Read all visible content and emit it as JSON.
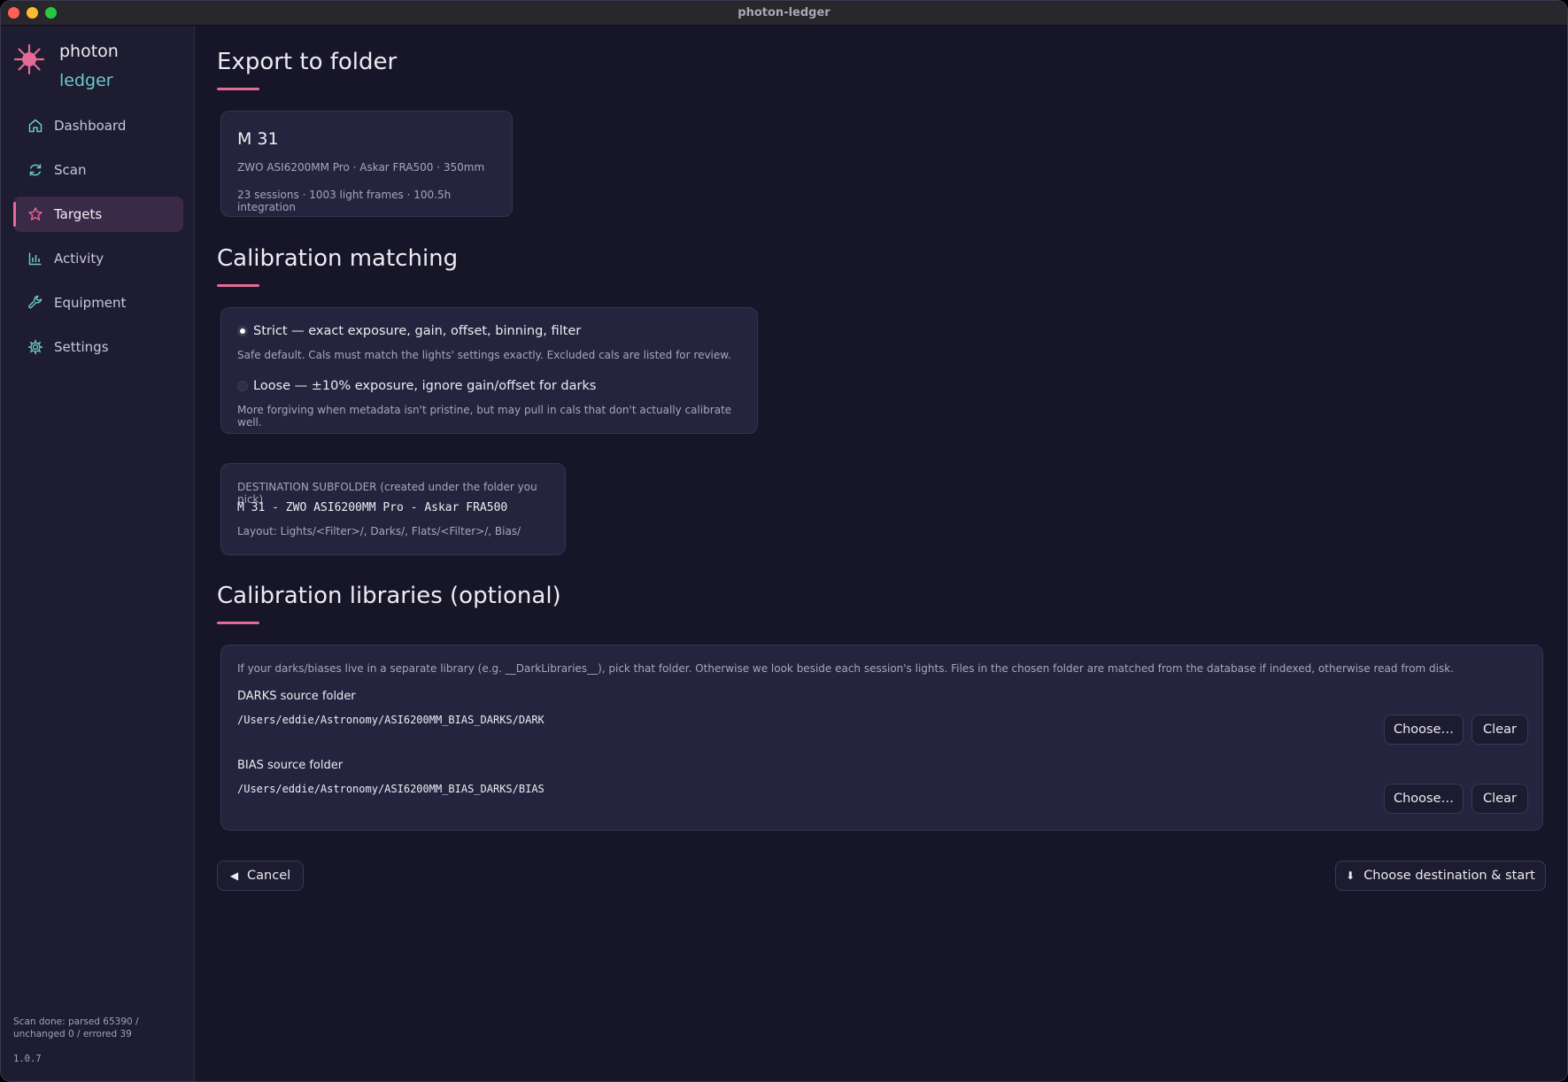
{
  "window": {
    "title": "photon-ledger"
  },
  "sidebar": {
    "brand_line1": "photon",
    "brand_line2": "ledger",
    "items": [
      {
        "label": "Dashboard",
        "icon": "home-icon",
        "active": false
      },
      {
        "label": "Scan",
        "icon": "refresh-icon",
        "active": false
      },
      {
        "label": "Targets",
        "icon": "star-icon",
        "active": true
      },
      {
        "label": "Activity",
        "icon": "bar-chart-icon",
        "active": false
      },
      {
        "label": "Equipment",
        "icon": "wrench-icon",
        "active": false
      },
      {
        "label": "Settings",
        "icon": "gear-icon",
        "active": false
      }
    ],
    "scan_status": "Scan done: parsed 65390 / unchanged 0 / errored 39",
    "version": "1.0.7"
  },
  "export": {
    "heading": "Export to folder",
    "target": {
      "name": "M 31",
      "equipment": "ZWO ASI6200MM Pro · Askar FRA500 · 350mm",
      "stats": "23 sessions · 1003 light frames · 100.5h integration"
    }
  },
  "calibration": {
    "heading": "Calibration matching",
    "options": [
      {
        "label": "Strict — exact exposure, gain, offset, binning, filter",
        "desc": "Safe default. Cals must match the lights' settings exactly. Excluded cals are listed for review.",
        "selected": true
      },
      {
        "label": "Loose — ±10% exposure, ignore gain/offset for darks",
        "desc": "More forgiving when metadata isn't pristine, but may pull in cals that don't actually calibrate well.",
        "selected": false
      }
    ]
  },
  "destination": {
    "label": "DESTINATION SUBFOLDER (created under the folder you pick)",
    "path": "M 31 - ZWO ASI6200MM Pro - Askar FRA500",
    "layout": "Layout: Lights/<Filter>/, Darks/, Flats/<Filter>/, Bias/"
  },
  "libraries": {
    "heading": "Calibration libraries (optional)",
    "note": "If your darks/biases live in a separate library (e.g. __DarkLibraries__), pick that folder. Otherwise we look beside each session's lights. Files in the chosen folder are matched from the database if indexed, otherwise read from disk.",
    "darks_label": "DARKS source folder",
    "darks_path": "/Users/eddie/Astronomy/ASI6200MM_BIAS_DARKS/DARK",
    "bias_label": "BIAS source folder",
    "bias_path": "/Users/eddie/Astronomy/ASI6200MM_BIAS_DARKS/BIAS",
    "choose_label": "Choose…",
    "clear_label": "Clear"
  },
  "actions": {
    "cancel_label": "Cancel",
    "start_label": "Choose destination & start"
  },
  "colors": {
    "accent": "#e56a97",
    "brand_teal": "#6cc9c9",
    "background": "#171628",
    "card": "#25243e"
  }
}
